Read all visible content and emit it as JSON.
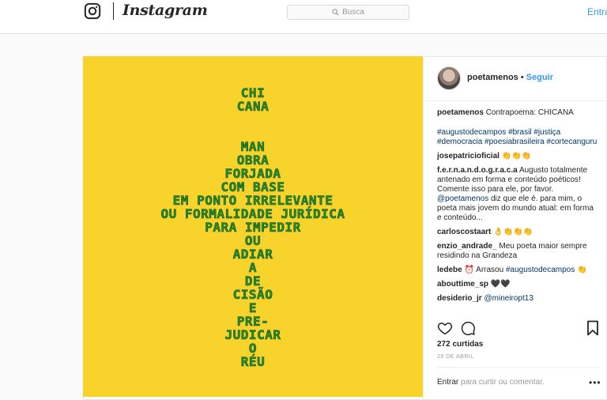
{
  "nav": {
    "wordmark": "Instagram",
    "search_placeholder": "Busca",
    "login": "Entrar"
  },
  "poem_lines": [
    "CHI",
    "CANA",
    "",
    "MAN",
    "OBRA",
    "FORJADA",
    "COM BASE",
    "EM PONTO IRRELEVANTE",
    "OU FORMALIDADE JURÍDICA",
    "PARA IMPEDIR",
    "OU",
    "ADIAR",
    "A",
    "DE",
    "CISÃO",
    "E",
    "PRE-",
    "JUDICAR",
    "O",
    "RÉU"
  ],
  "post": {
    "username": "poetamenos",
    "follow": "Seguir",
    "caption_text": "Contrapoema: CHICANA",
    "hashtags": "#augustodecampos #brasil #justiça #democracia #poesiabrasileira #cortecanguru",
    "comments": [
      {
        "user": "josepatricioficial",
        "text": "👏👏👏"
      },
      {
        "user": "f.e.r.n.a.n.d.o.g.r.a.c.a",
        "text": "Augusto totalmente antenado em forma e conteúdo poéticos! Comente isso para ele, por favor.",
        "mention": "@poetamenos",
        "text2": "diz que ele é. para mim, o poeta mais jovem do mundo atual: em forma e conteúdo..."
      },
      {
        "user": "carloscostaart",
        "text": "👌👏👏👏"
      },
      {
        "user": "enzio_andrade_",
        "text": "Meu poeta maior sempre residindo na Grandeza"
      },
      {
        "user": "ledebe",
        "text": "⏰ Arrasou",
        "tag": "#augustodecampos",
        "text2": "👏"
      },
      {
        "user": "abouttime_sp",
        "text": "🖤🖤"
      },
      {
        "user": "desiderio_jr",
        "mention": "@mineiropt13"
      }
    ],
    "likes": "272 curtidas",
    "date": "29 DE ABRIL",
    "comment_login": "Entrar",
    "comment_prompt": "para curtir ou comentar.",
    "more": "•••"
  },
  "colors": {
    "image_bg": "#f7d32b",
    "poem_text": "#2a8a2e",
    "link_blue": "#3897f0",
    "hashtag": "#003569"
  },
  "icons": [
    "instagram-glyph-icon",
    "search-icon",
    "heart-icon",
    "comment-icon",
    "bookmark-icon",
    "more-options-icon"
  ]
}
